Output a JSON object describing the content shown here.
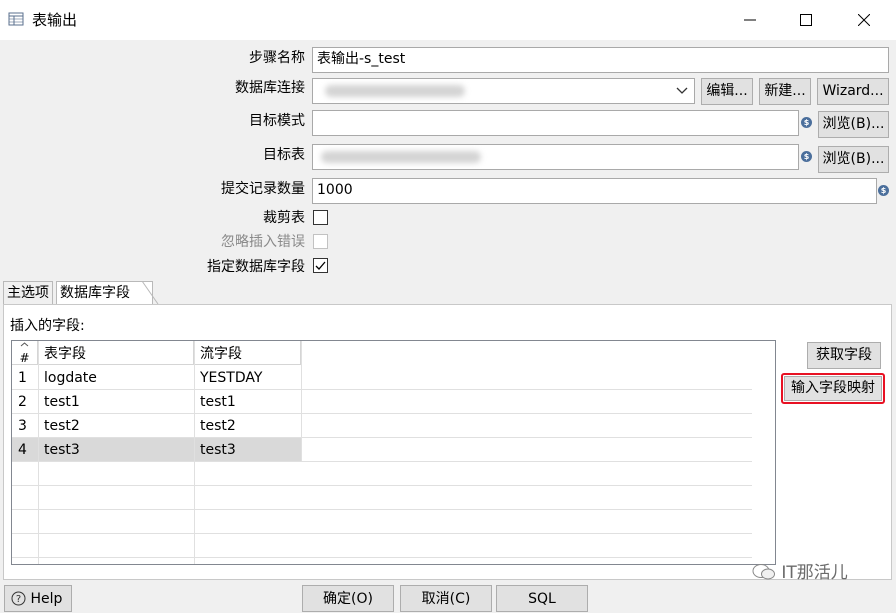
{
  "window": {
    "title": "表输出",
    "icon": "table-output-icon"
  },
  "form": {
    "step_name_label": "步骤名称",
    "step_name_value": "表输出-s_test",
    "db_connection_label": "数据库连接",
    "db_connection_value": "",
    "edit_button": "编辑...",
    "new_button": "新建...",
    "wizard_button": "Wizard...",
    "target_schema_label": "目标模式",
    "target_schema_value": "",
    "browse_schema_button": "浏览(B)...",
    "target_table_label": "目标表",
    "target_table_value": "",
    "browse_table_button": "浏览(B)...",
    "commit_size_label": "提交记录数量",
    "commit_size_value": "1000",
    "truncate_label": "裁剪表",
    "truncate_checked": false,
    "ignore_errors_label": "忽略插入错误",
    "ignore_errors_checked": false,
    "specify_fields_label": "指定数据库字段",
    "specify_fields_checked": true
  },
  "tabs": [
    {
      "label": "主选项",
      "active": false
    },
    {
      "label": "数据库字段",
      "active": true
    }
  ],
  "fields_panel": {
    "title": "插入的字段:",
    "get_fields_button": "获取字段",
    "input_mapping_button": "输入字段映射",
    "columns": [
      "#",
      "表字段",
      "流字段"
    ],
    "rows": [
      {
        "num": "1",
        "table_field": "logdate",
        "stream_field": "YESTDAY",
        "selected": false
      },
      {
        "num": "2",
        "table_field": "test1",
        "stream_field": "test1",
        "selected": false
      },
      {
        "num": "3",
        "table_field": "test2",
        "stream_field": "test2",
        "selected": false
      },
      {
        "num": "4",
        "table_field": "test3",
        "stream_field": "test3",
        "selected": true
      }
    ]
  },
  "bottom_bar": {
    "help_button": "Help",
    "ok_button": "确定(O)",
    "cancel_button": "取消(C)",
    "sql_button": "SQL"
  },
  "watermark": "IT那活儿",
  "colors": {
    "highlight_border": "#e81123",
    "selected_row": "#d9d9d9",
    "variable_icon": "#4b6f9c"
  }
}
